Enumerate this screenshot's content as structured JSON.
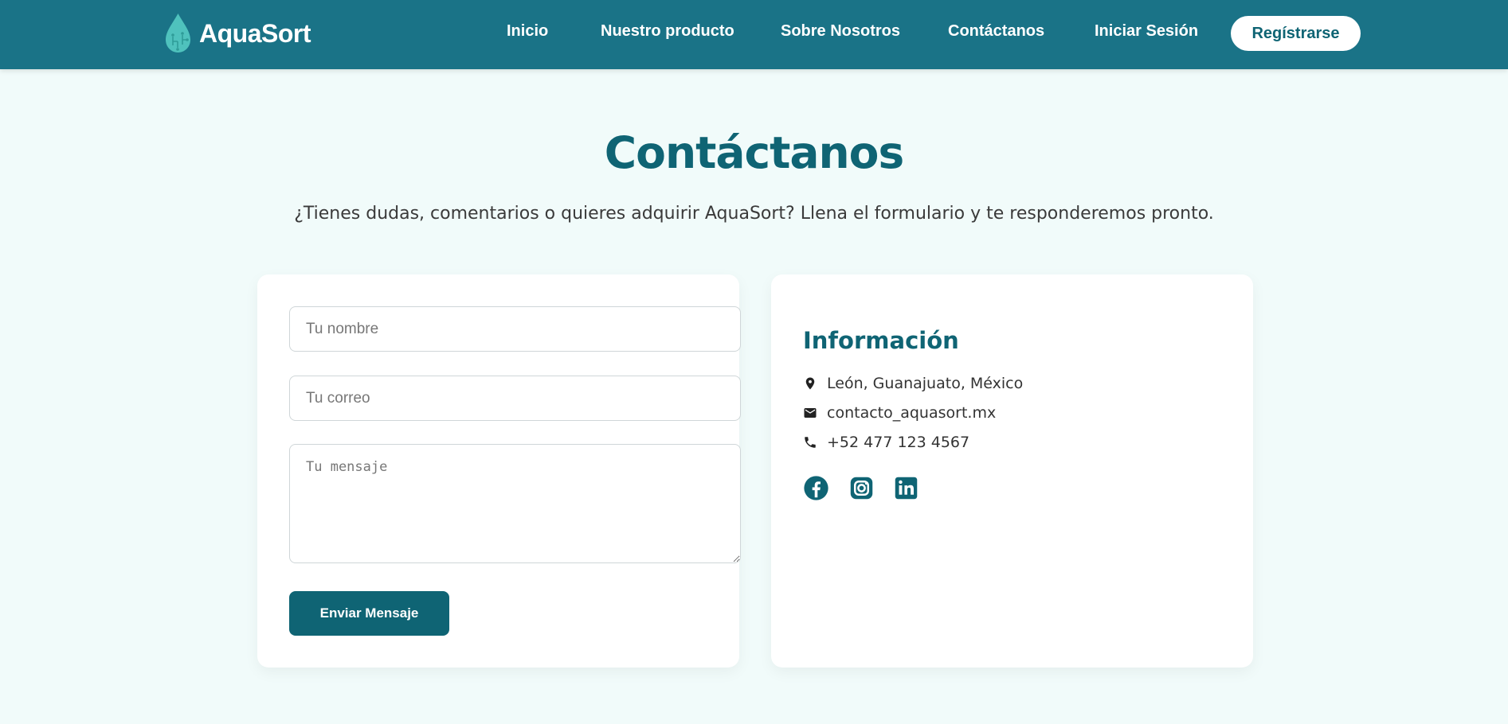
{
  "brand": {
    "name": "AquaSort"
  },
  "nav": {
    "links": [
      "Inicio",
      "Nuestro producto",
      "Sobre Nosotros",
      "Contáctanos",
      "Iniciar Sesión"
    ],
    "register_label": "Regístrarse"
  },
  "page": {
    "title": "Contáctanos",
    "subtitle": "¿Tienes dudas, comentarios o quieres adquirir AquaSort? Llena el formulario y te responderemos pronto."
  },
  "form": {
    "name_placeholder": "Tu nombre",
    "email_placeholder": "Tu correo",
    "message_placeholder": "Tu mensaje",
    "submit_label": "Enviar Mensaje"
  },
  "info": {
    "title": "Información",
    "location": "León, Guanajuato, México",
    "email": "contacto_aquasort.mx",
    "phone": "+52 477 123 4567",
    "icons": [
      "location-pin-icon",
      "mail-icon",
      "phone-icon"
    ],
    "socials": [
      "facebook-icon",
      "instagram-icon",
      "linkedin-icon"
    ]
  },
  "colors": {
    "navbar": "#1a7387",
    "accent": "#0f6474",
    "background": "#f1fbfa",
    "logo_drop": "#4fc2bd"
  }
}
